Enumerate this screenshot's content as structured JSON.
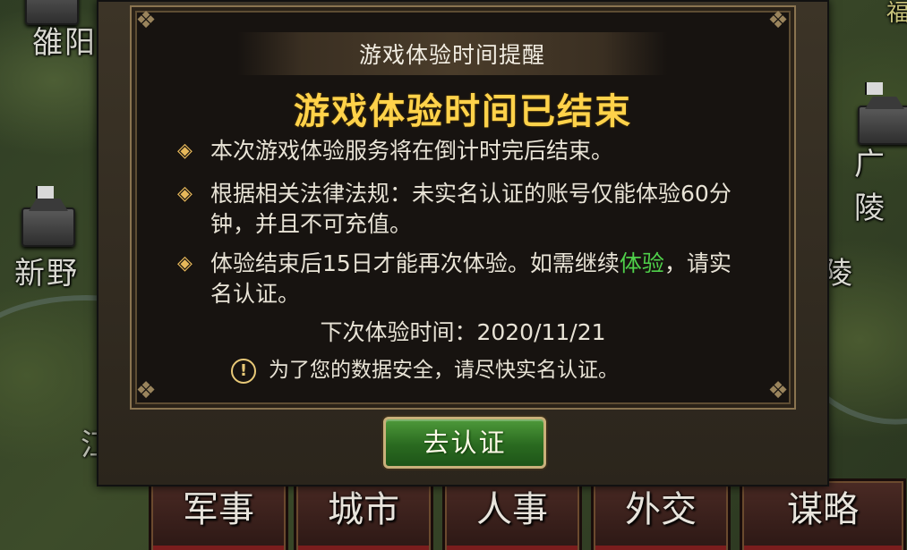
{
  "map": {
    "cities": [
      {
        "id": "luoyang",
        "label": "雒阳"
      },
      {
        "id": "xinye",
        "label": "新野"
      },
      {
        "id": "guangling",
        "label": "广陵"
      },
      {
        "id": "ling",
        "label": "陵"
      },
      {
        "id": "fu",
        "label": "福"
      },
      {
        "id": "jiang",
        "label": "江"
      }
    ]
  },
  "bottom_menu": {
    "items": [
      {
        "label": "军事"
      },
      {
        "label": "城市"
      },
      {
        "label": "人事"
      },
      {
        "label": "外交"
      },
      {
        "label": "谋略"
      }
    ]
  },
  "dialog": {
    "header": "游戏体验时间提醒",
    "title": "游戏体验时间已结束",
    "rules": [
      {
        "text": "本次游戏体验服务将在倒计时完后结束。"
      },
      {
        "text": "根据相关法律法规：未实名认证的账号仅能体验60分钟，并且不可充值。"
      },
      {
        "text_before": "体验结束后15日才能再次体验。如需继续",
        "highlight": "体验",
        "text_after": "，请实名认证。"
      }
    ],
    "next_label": "下次体验时间：",
    "next_date": "2020/11/21",
    "warning_icon": "!",
    "warning": "为了您的数据安全，请尽快实名认证。",
    "verify_button": "去认证"
  },
  "colors": {
    "title_gold": "#ffd24a",
    "highlight_green": "#4fd04a",
    "button_green": "#2a6a20"
  }
}
